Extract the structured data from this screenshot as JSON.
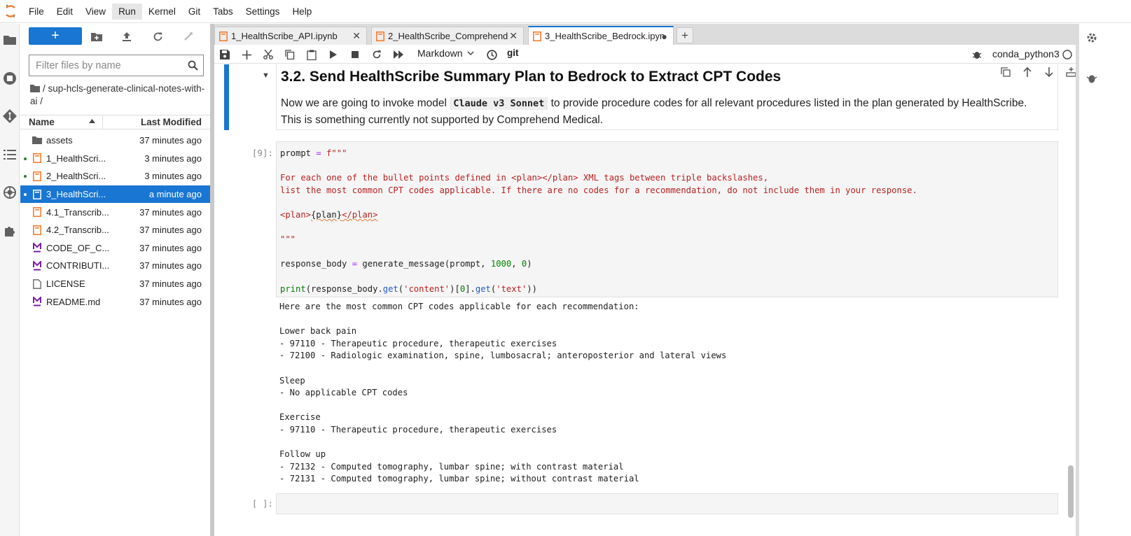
{
  "menu": [
    "File",
    "Edit",
    "View",
    "Run",
    "Kernel",
    "Git",
    "Tabs",
    "Settings",
    "Help"
  ],
  "menu_active": "Run",
  "filebrowser": {
    "new_label": "+",
    "filter_placeholder": "Filter files by name",
    "breadcrumb": "/ sup-hcls-generate-clinical-notes-with-ai /",
    "col_name": "Name",
    "col_modified": "Last Modified",
    "files": [
      {
        "name": "assets",
        "modified": "37 minutes ago",
        "icon": "folder-icon",
        "running": false,
        "selected": false
      },
      {
        "name": "1_HealthScri...",
        "modified": "3 minutes ago",
        "icon": "notebook-icon",
        "running": true,
        "selected": false
      },
      {
        "name": "2_HealthScri...",
        "modified": "3 minutes ago",
        "icon": "notebook-icon",
        "running": true,
        "selected": false
      },
      {
        "name": "3_HealthScri...",
        "modified": "a minute ago",
        "icon": "notebook-icon",
        "running": true,
        "selected": true
      },
      {
        "name": "4.1_Transcrib...",
        "modified": "37 minutes ago",
        "icon": "notebook-icon",
        "running": false,
        "selected": false
      },
      {
        "name": "4.2_Transcrib...",
        "modified": "37 minutes ago",
        "icon": "notebook-icon",
        "running": false,
        "selected": false
      },
      {
        "name": "CODE_OF_C...",
        "modified": "37 minutes ago",
        "icon": "markdown-icon",
        "running": false,
        "selected": false
      },
      {
        "name": "CONTRIBUTI...",
        "modified": "37 minutes ago",
        "icon": "markdown-icon",
        "running": false,
        "selected": false
      },
      {
        "name": "LICENSE",
        "modified": "37 minutes ago",
        "icon": "file-icon",
        "running": false,
        "selected": false
      },
      {
        "name": "README.md",
        "modified": "37 minutes ago",
        "icon": "markdown-icon",
        "running": false,
        "selected": false
      }
    ]
  },
  "tabs": [
    {
      "title": "1_HealthScribe_API.ipynb",
      "active": false,
      "close": "✕"
    },
    {
      "title": "2_HealthScribe_Comprehend",
      "active": false,
      "close": "✕"
    },
    {
      "title": "3_HealthScribe_Bedrock.ipyn",
      "active": true,
      "close": "●"
    }
  ],
  "toolbar": {
    "cell_type": "Markdown",
    "git": "git",
    "kernel": "conda_python3"
  },
  "markdown_cell": {
    "heading": "3.2. Send HealthScribe Summary Plan to Bedrock to Extract CPT Codes",
    "para_before": "Now we are going to invoke model ",
    "model": "Claude v3 Sonnet",
    "para_after": " to provide procedure codes for all relevant procedures listed in the plan generated by HealthScribe. This is something currently not supported by Comprehend Medical."
  },
  "code_cell": {
    "prompt": "[9]:",
    "lines": {
      "l1a": "prompt ",
      "l1b": "=",
      "l1c": " f\"\"\"",
      "l2": "For each one of the bullet points defined in <plan></plan> XML tags between triple backslashes,",
      "l3": "list the most common CPT codes applicable. If there are no codes for a recommendation, do not include them in your response.",
      "l4a": "<plan>",
      "l4b": "{plan}",
      "l4c": "</plan>",
      "l5": "\"\"\"",
      "l6a": "response_body ",
      "l6b": "=",
      "l6c": " generate_message(prompt, ",
      "l6d": "1000",
      "l6e": ", ",
      "l6f": "0",
      "l6g": ")",
      "l7a": "print",
      "l7b": "(response_body.",
      "l7c": "get",
      "l7d": "(",
      "l7e": "'content'",
      "l7f": ")[",
      "l7g": "0",
      "l7h": "].",
      "l7i": "get",
      "l7j": "(",
      "l7k": "'text'",
      "l7l": "))"
    }
  },
  "output": "Here are the most common CPT codes applicable for each recommendation:\n\nLower back pain\n- 97110 - Therapeutic procedure, therapeutic exercises\n- 72100 - Radiologic examination, spine, lumbosacral; anteroposterior and lateral views\n\nSleep\n- No applicable CPT codes\n\nExercise\n- 97110 - Therapeutic procedure, therapeutic exercises\n\nFollow up\n- 72132 - Computed tomography, lumbar spine; with contrast material\n- 72131 - Computed tomography, lumbar spine; without contrast material",
  "empty_cell_prompt": "[ ]:",
  "colors": {
    "accent": "#1976d2",
    "string": "#ba2121",
    "number": "#008000",
    "keyword": "#aa22ff",
    "running_dot": "#2e7d32",
    "notebook_icon": "#f37726",
    "markdown_icon": "#7b1fa2"
  }
}
